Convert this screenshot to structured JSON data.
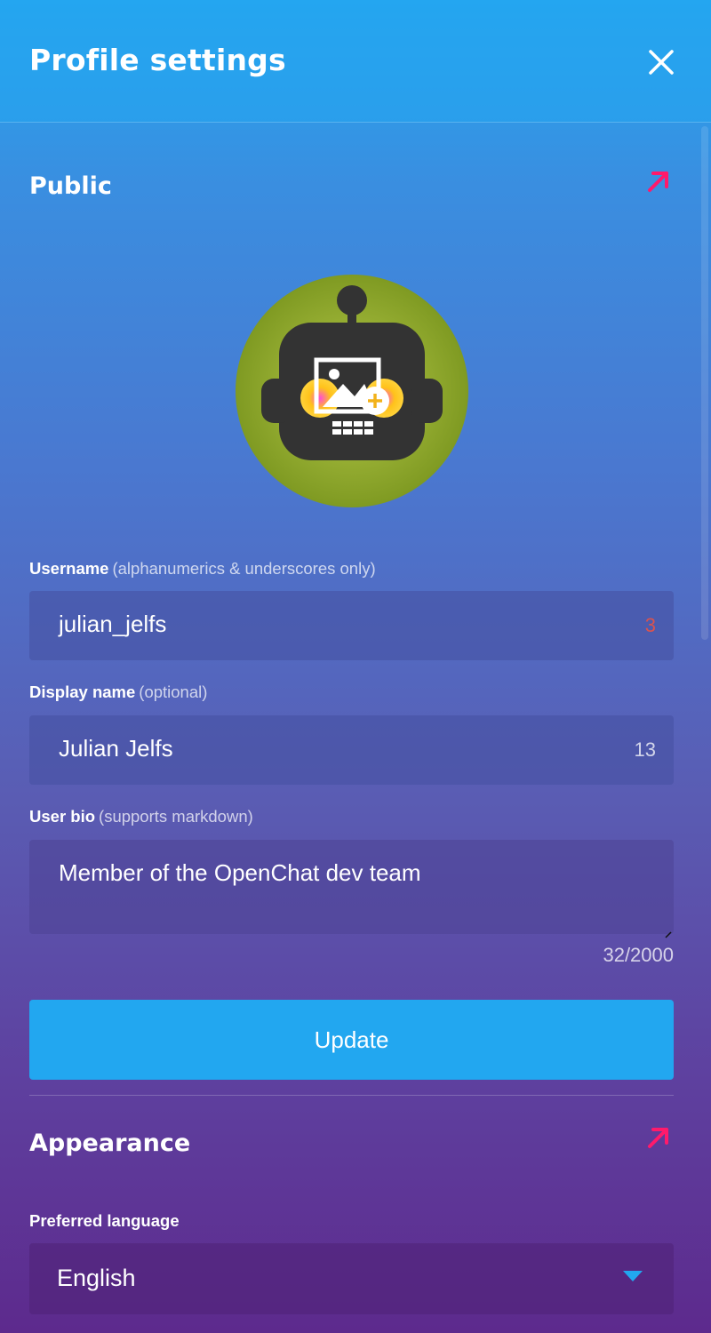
{
  "header": {
    "title": "Profile settings",
    "close_icon": "close-icon"
  },
  "public_section": {
    "title": "Public",
    "collapse_icon": "arrow-up-right-icon",
    "avatar_icon": "robot-avatar-icon",
    "change_photo_icon": "add-image-icon"
  },
  "username": {
    "label": "Username",
    "hint": "(alphanumerics & underscores only)",
    "value": "julian_jelfs",
    "counter": "3"
  },
  "display_name": {
    "label": "Display name",
    "hint": "(optional)",
    "value": "Julian Jelfs",
    "counter": "13"
  },
  "bio": {
    "label": "User bio",
    "hint": "(supports markdown)",
    "value": "Member of the OpenChat dev team",
    "counter": "32/2000"
  },
  "update_button": "Update",
  "appearance_section": {
    "title": "Appearance",
    "collapse_icon": "arrow-up-right-icon"
  },
  "language": {
    "label": "Preferred language",
    "selected": "English",
    "caret_icon": "caret-down-icon"
  },
  "colors": {
    "accent": "#22a7f0",
    "arrow": "#ff1a6b",
    "warn_counter": "#d9534f",
    "avatar_bg": "#8da52a"
  }
}
